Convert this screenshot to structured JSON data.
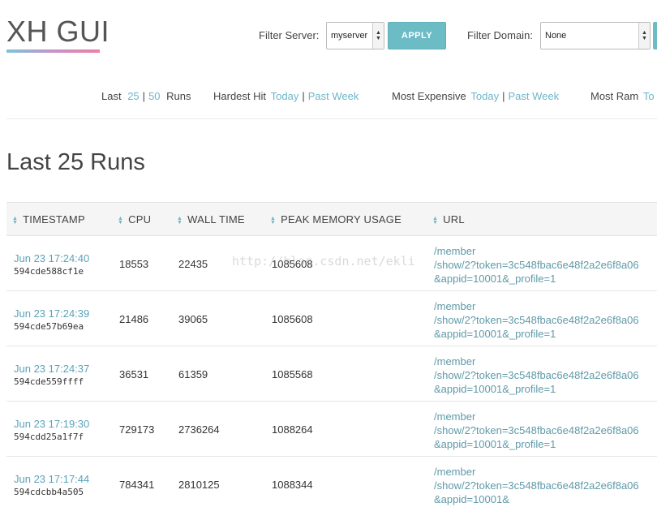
{
  "app": {
    "title": "XH GUI"
  },
  "filters": {
    "server_label": "Filter Server:",
    "server_value": "myserver",
    "apply_label": "APPLY",
    "domain_label": "Filter Domain:",
    "domain_value": "None"
  },
  "nav": {
    "last": "Last",
    "last_25": "25",
    "sep": "|",
    "last_50": "50",
    "runs": "Runs",
    "hardest_hit": "Hardest Hit",
    "most_expensive": "Most Expensive",
    "most_ram": "Most Ram",
    "today": "Today",
    "past_week": "Past Week",
    "to_trunc": "To"
  },
  "page": {
    "title": "Last 25 Runs"
  },
  "table": {
    "headers": [
      "TIMESTAMP",
      "CPU",
      "WALL TIME",
      "PEAK MEMORY USAGE",
      "URL"
    ],
    "rows": [
      {
        "time": "Jun 23 17:24:40",
        "id": "594cde588cf1e",
        "cpu": "18553",
        "wall": "22435",
        "mem": "1085608",
        "url1": "/member",
        "url2": "/show/2?token=3c548fbac6e48f2a2e6f8a06",
        "url3": "&appid=10001&_profile=1"
      },
      {
        "time": "Jun 23 17:24:39",
        "id": "594cde57b69ea",
        "cpu": "21486",
        "wall": "39065",
        "mem": "1085608",
        "url1": "/member",
        "url2": "/show/2?token=3c548fbac6e48f2a2e6f8a06",
        "url3": "&appid=10001&_profile=1"
      },
      {
        "time": "Jun 23 17:24:37",
        "id": "594cde559ffff",
        "cpu": "36531",
        "wall": "61359",
        "mem": "1085568",
        "url1": "/member",
        "url2": "/show/2?token=3c548fbac6e48f2a2e6f8a06",
        "url3": "&appid=10001&_profile=1"
      },
      {
        "time": "Jun 23 17:19:30",
        "id": "594cdd25a1f7f",
        "cpu": "729173",
        "wall": "2736264",
        "mem": "1088264",
        "url1": "/member",
        "url2": "/show/2?token=3c548fbac6e48f2a2e6f8a06",
        "url3": "&appid=10001&_profile=1"
      },
      {
        "time": "Jun 23 17:17:44",
        "id": "594cdcbb4a505",
        "cpu": "784341",
        "wall": "2810125",
        "mem": "1088344",
        "url1": "/member",
        "url2": "/show/2?token=3c548fbac6e48f2a2e6f8a06",
        "url3": "&appid=10001&"
      }
    ]
  },
  "watermark": "http://blog.csdn.net/ekli",
  "icons": {
    "sort": "sort-arrows-icon",
    "dropdown": "dropdown-arrow-icon"
  },
  "colors": {
    "accent": "#6cbcc6",
    "link": "#6cb6c8"
  }
}
